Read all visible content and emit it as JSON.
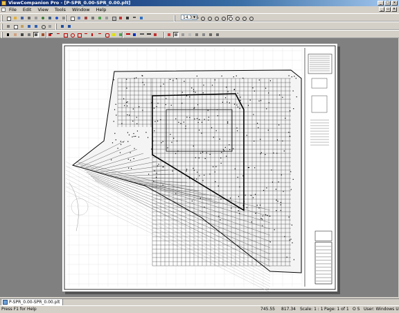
{
  "window": {
    "title": "ViewCompanion Pro - [P-SPR_0.00-SPR_0.00.plt]"
  },
  "menu": {
    "items": [
      "File",
      "Edit",
      "View",
      "Tools",
      "Window",
      "Help"
    ]
  },
  "toolbar": {
    "zoom_value": "14.37%"
  },
  "document_tab": {
    "label": "P-SPR_0.00-SPR_0.00.plt"
  },
  "status": {
    "help": "Press F1 for Help",
    "x": "745.55",
    "y": "817.34",
    "scale": "Scale: 1 : 1",
    "page": "Page: 1 of 1",
    "flags": "O  S",
    "user": "User: Windows User"
  },
  "colors": {
    "titlebar": "#0a246a",
    "workspace": "#808080",
    "chrome": "#d4d0c8"
  }
}
